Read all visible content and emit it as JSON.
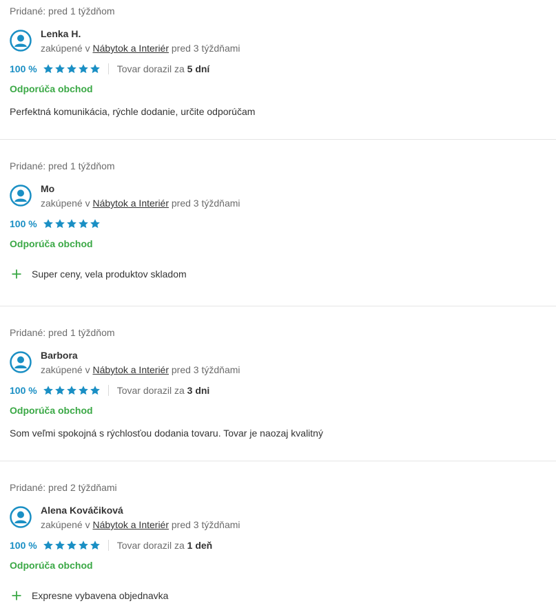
{
  "reviews": [
    {
      "added": "Pridané: pred 1 týždňom",
      "name": "Lenka H.",
      "bought_prefix": "zakúpené v",
      "category": "Nábytok a Interiér",
      "bought_when": "pred 3 týždňami",
      "percent": "100 %",
      "stars": 5,
      "delivery_label": "Tovar dorazil za",
      "delivery_value": "5 dní",
      "recommend": "Odporúča obchod",
      "text": "Perfektná komunikácia, rýchle dodanie, určite odporúčam"
    },
    {
      "added": "Pridané: pred 1 týždňom",
      "name": "Mo",
      "bought_prefix": "zakúpené v",
      "category": "Nábytok a Interiér",
      "bought_when": "pred 3 týždňami",
      "percent": "100 %",
      "stars": 5,
      "recommend": "Odporúča obchod",
      "pro": "Super ceny, vela produktov skladom"
    },
    {
      "added": "Pridané: pred 1 týždňom",
      "name": "Barbora",
      "bought_prefix": "zakúpené v",
      "category": "Nábytok a Interiér",
      "bought_when": "pred 3 týždňami",
      "percent": "100 %",
      "stars": 5,
      "delivery_label": "Tovar dorazil za",
      "delivery_value": "3 dni",
      "recommend": "Odporúča obchod",
      "text": "Som veľmi spokojná s rýchlosťou dodania tovaru. Tovar je naozaj kvalitný"
    },
    {
      "added": "Pridané: pred 2 týždňami",
      "name": "Alena Kováčiková",
      "bought_prefix": "zakúpené v",
      "category": "Nábytok a Interiér",
      "bought_when": "pred 3 týždňami",
      "percent": "100 %",
      "stars": 5,
      "delivery_label": "Tovar dorazil za",
      "delivery_value": "1 deň",
      "recommend": "Odporúča obchod",
      "pro": "Expresne vybavena objednavka"
    }
  ],
  "colors": {
    "accent": "#1a8fc4",
    "recommend": "#3aa845",
    "muted": "#6b6b6b"
  },
  "icons": {
    "avatar": "user-avatar-icon",
    "star": "star-icon",
    "plus": "plus-icon"
  }
}
